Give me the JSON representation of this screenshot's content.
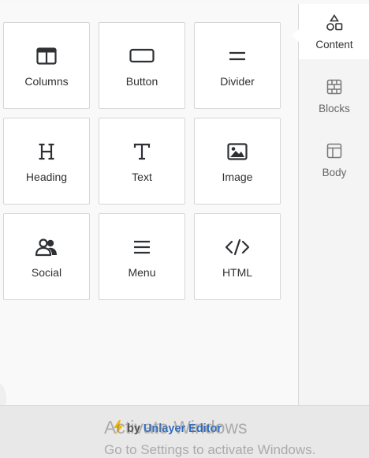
{
  "tools": [
    {
      "label": "Columns",
      "icon": "columns-icon"
    },
    {
      "label": "Button",
      "icon": "button-icon"
    },
    {
      "label": "Divider",
      "icon": "divider-icon"
    },
    {
      "label": "Heading",
      "icon": "heading-icon"
    },
    {
      "label": "Text",
      "icon": "text-icon"
    },
    {
      "label": "Image",
      "icon": "image-icon"
    },
    {
      "label": "Social",
      "icon": "social-icon"
    },
    {
      "label": "Menu",
      "icon": "menu-icon"
    },
    {
      "label": "HTML",
      "icon": "html-icon"
    }
  ],
  "sidebar": {
    "tabs": [
      {
        "label": "Content",
        "icon": "shapes-icon",
        "active": true
      },
      {
        "label": "Blocks",
        "icon": "blocks-icon",
        "active": false
      },
      {
        "label": "Body",
        "icon": "body-layout-icon",
        "active": false
      }
    ]
  },
  "footer": {
    "by": "by",
    "link": "Unlayer Editor",
    "bolt_icon": "bolt-icon"
  },
  "watermark": {
    "line1": "Activate Windows",
    "line2": "Go to Settings to activate Windows."
  },
  "colors": {
    "link": "#2a6bc6",
    "bolt": "#f4b400",
    "icon": "#2f3033"
  }
}
